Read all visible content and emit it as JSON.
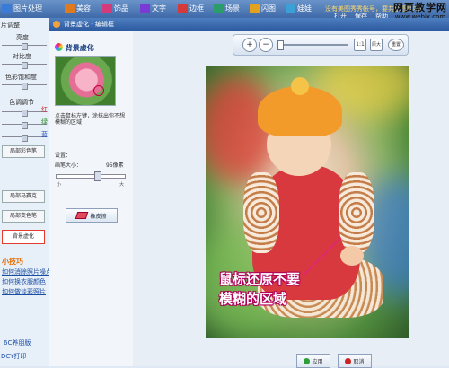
{
  "topbar": {
    "tabs": [
      {
        "label": "图片处理",
        "icon": "picture-icon",
        "color": "#3a7bd5"
      },
      {
        "label": "美容",
        "icon": "beauty-icon",
        "color": "#e07a1f"
      },
      {
        "label": "饰品",
        "icon": "accessory-icon",
        "color": "#d53a7a"
      },
      {
        "label": "文字",
        "icon": "text-icon",
        "color": "#7a3ad5"
      },
      {
        "label": "边框",
        "icon": "frame-icon",
        "color": "#d53a3a"
      },
      {
        "label": "场景",
        "icon": "scene-icon",
        "color": "#2a9d6a"
      },
      {
        "label": "闪图",
        "icon": "flash-icon",
        "color": "#e0a21f"
      },
      {
        "label": "娃娃",
        "icon": "doll-icon",
        "color": "#3aa0d5"
      }
    ],
    "status_text": "没有美图秀秀帐号，要共享图片吗？",
    "right_menu": [
      "打开",
      "保存",
      "帮助"
    ]
  },
  "watermark": {
    "line1": "网页教学网",
    "line2": "www.webjx.com"
  },
  "left_strip": {
    "header": "片调整",
    "adjustments": [
      "亮度",
      "对比度",
      "色彩饱和度",
      "色调调节"
    ],
    "color_marks": [
      "红",
      "绿",
      "蓝"
    ],
    "buttons": [
      "局部彩色笔",
      "局部马赛克",
      "局部变色笔",
      "背景虚化"
    ],
    "active_button_index": 3,
    "tips_title": "小技巧",
    "tips": [
      "如何消除照片噪点",
      "如何换衣服颜色",
      "如何做淡彩照片"
    ],
    "footer1": "6C养朋版",
    "footer2": "DCY打印"
  },
  "dialog": {
    "title": "背景虚化 - 编辑框",
    "panel_title": "背景虚化",
    "description": "点击鼠标左键，涂抹出你不想模糊的区域",
    "settings_label": "设置：",
    "brush_label": "画笔大小：",
    "brush_value": "95像素",
    "brush_fraction": 0.6,
    "brush_min": "小",
    "brush_max": "大",
    "eraser_label": "橡皮擦"
  },
  "viewer": {
    "zoom_in": "+",
    "zoom_out": "−",
    "zoom_fraction": 0.02,
    "fit_label": "1:1",
    "actual_label": "原大",
    "reset_label": "重置"
  },
  "callout": {
    "line1": "鼠标还原不要",
    "line2": "模糊的区域"
  },
  "actions": {
    "ok": "应用",
    "cancel": "取消"
  }
}
